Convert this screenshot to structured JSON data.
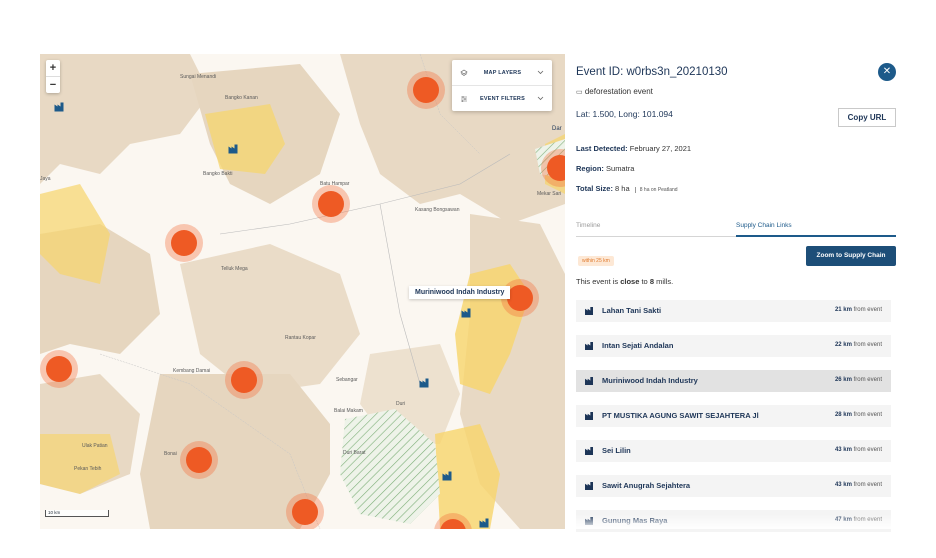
{
  "map": {
    "zoom_in": "+",
    "zoom_out": "−",
    "layers": [
      {
        "label": "MAP LAYERS",
        "icon": "layers-icon"
      },
      {
        "label": "EVENT FILTERS",
        "icon": "filter-sliders-icon"
      }
    ],
    "tooltip": "Muriniwood Indah Industry",
    "scale": "10 km",
    "places": [
      "Sungai Menandi",
      "Bangko Kanan",
      "Bangko Bakti",
      "Batu Hampar",
      "Kasang Bongsawan",
      "Mekar Sari",
      "Telluk Mega",
      "Rantau Kopar",
      "Kembang Damai",
      "Sebangar",
      "Balai Makam",
      "Duri",
      "Duri Barat",
      "Bonai",
      "Ulak Patian",
      "Pekan Tebih",
      "Jaya",
      "Dar"
    ]
  },
  "panel": {
    "title": "Event ID: w0rbs3n_20210130",
    "event_type": "deforestation event",
    "coords": "Lat: 1.500, Long: 101.094",
    "copy_url": "Copy URL",
    "last_detected_label": "Last Detected:",
    "last_detected_value": "February 27, 2021",
    "region_label": "Region:",
    "region_value": "Sumatra",
    "total_size_label": "Total Size:",
    "total_size_value": "8 ha",
    "peatland": "8 ha on Peatland",
    "tabs": [
      "Timeline",
      "Supply Chain Links"
    ],
    "badge": "within 25 km",
    "zoom_chain": "Zoom to Supply Chain",
    "close_to_prefix": "This event is ",
    "close_to_bold": "close",
    "close_to_mid": " to ",
    "close_to_count": "8",
    "close_to_suffix": " mills.",
    "from_event": "from event",
    "mills": [
      {
        "name": "Lahan Tani Sakti",
        "dist": "21 km"
      },
      {
        "name": "Intan Sejati Andalan",
        "dist": "22 km"
      },
      {
        "name": "Muriniwood Indah Industry",
        "dist": "26 km"
      },
      {
        "name": "PT MUSTIKA AGUNG SAWIT SEJAHTERA Jl",
        "dist": "28 km"
      },
      {
        "name": "Sei Lilin",
        "dist": "43 km"
      },
      {
        "name": "Sawit Anugrah Sejahtera",
        "dist": "43 km"
      },
      {
        "name": "Gunung Mas Raya",
        "dist": "47 km"
      }
    ],
    "colors": {
      "accent": "#1d4e78",
      "cluster": "#ee5a24",
      "peat": "#f7d46b"
    }
  }
}
